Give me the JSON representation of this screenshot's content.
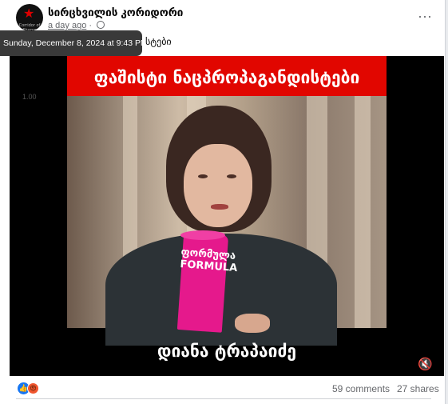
{
  "post": {
    "page_name": "სირცხვილის კორიდორი",
    "time_ago": "a day ago",
    "tooltip_datetime": "Sunday, December 8, 2024 at 9:43 PM",
    "caption_fragment": "სტები",
    "more_icon": "more-horizontal-icon",
    "privacy_icon": "globe-icon",
    "avatar_text": "Corridor of Shame"
  },
  "video": {
    "playback_speed": "1.00",
    "banner_text": "ფაშისტი ნაცპროპაგანდისტები",
    "name_text": "დიანა ტრაპაიძე",
    "mic_text": "ფორმულა FORMULA",
    "volume_icon": "volume-muted-icon",
    "banner_color": "#e10600"
  },
  "stats": {
    "reactions": [
      "like-icon",
      "angry-icon"
    ],
    "comments": "59 comments",
    "shares": "27 shares"
  }
}
